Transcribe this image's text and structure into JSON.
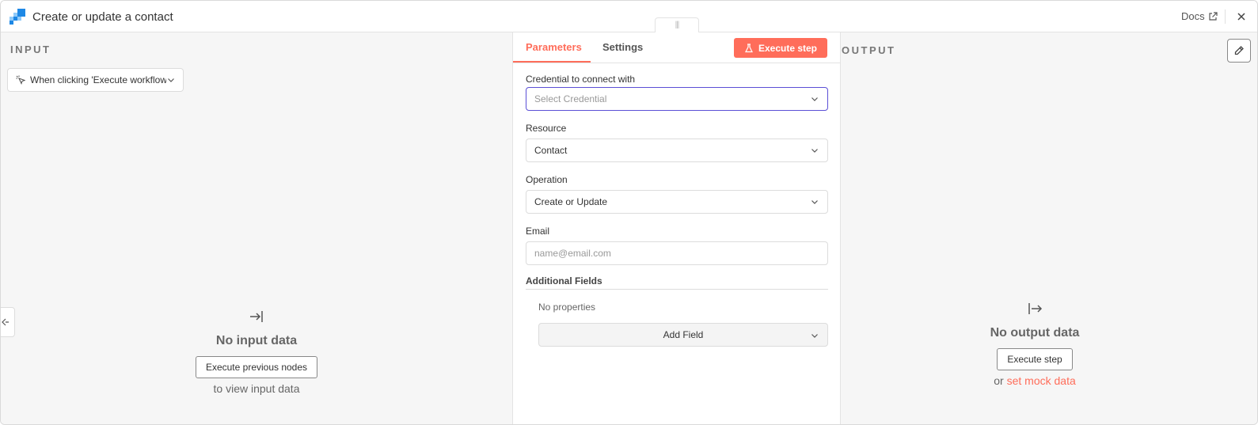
{
  "window": {
    "title": "Create or update a contact",
    "docs_label": "Docs",
    "drag_handle_glyph": "|||"
  },
  "input": {
    "panel_title": "INPUT",
    "trigger_select": "When clicking 'Execute workflow'",
    "empty_title": "No input data",
    "execute_prev_label": "Execute previous nodes",
    "hint": "to view input data"
  },
  "params": {
    "tabs": [
      "Parameters",
      "Settings"
    ],
    "active_tab": "Parameters",
    "execute_label": "Execute step",
    "credential": {
      "label": "Credential to connect with",
      "placeholder": "Select Credential"
    },
    "resource": {
      "label": "Resource",
      "value": "Contact"
    },
    "operation": {
      "label": "Operation",
      "value": "Create or Update"
    },
    "email": {
      "label": "Email",
      "placeholder": "name@email.com",
      "value": ""
    },
    "additional_fields": {
      "title": "Additional Fields",
      "empty_text": "No properties",
      "add_label": "Add Field"
    }
  },
  "output": {
    "panel_title": "OUTPUT",
    "empty_title": "No output data",
    "execute_label": "Execute step",
    "or_text": "or",
    "mock_link": "set mock data"
  },
  "colors": {
    "accent": "#ff6d5a",
    "focus": "#5b4fd6",
    "panel_bg": "#f6f6f6",
    "logo_primary": "#1e88e5",
    "logo_secondary": "#90caf9"
  },
  "icons": {
    "logo": "app-logo",
    "external": "external-link-icon",
    "close": "close-icon",
    "pointer": "cursor-click-icon",
    "flask": "flask-icon",
    "input_arrow": "arrow-to-right-bar-icon",
    "output_arrow": "arrow-from-bar-icon",
    "pencil": "pencil-icon"
  }
}
